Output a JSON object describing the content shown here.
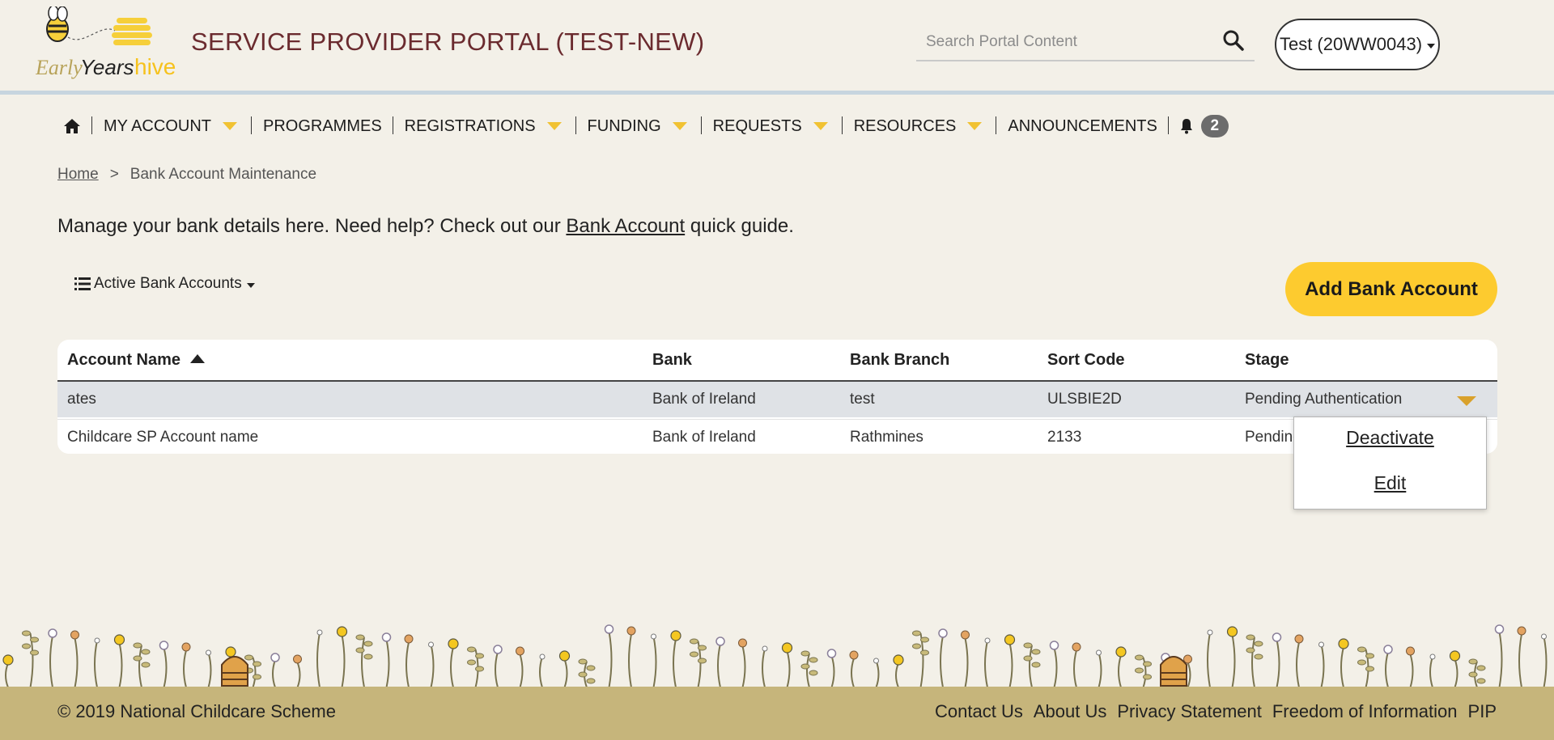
{
  "header": {
    "logo_text_1": "Early",
    "logo_text_2": "Years",
    "logo_text_3": "hive",
    "title": "SERVICE PROVIDER PORTAL (TEST-NEW)",
    "search_placeholder": "Search Portal Content",
    "account_label": "Test (20WW0043)"
  },
  "nav": {
    "items": [
      {
        "label": "MY ACCOUNT"
      },
      {
        "label": "PROGRAMMES"
      },
      {
        "label": "REGISTRATIONS"
      },
      {
        "label": "FUNDING"
      },
      {
        "label": "REQUESTS"
      },
      {
        "label": "RESOURCES"
      },
      {
        "label": "ANNOUNCEMENTS"
      }
    ],
    "notification_count": "2"
  },
  "breadcrumb": {
    "home": "Home",
    "separator": ">",
    "current": "Bank Account Maintenance"
  },
  "intro": {
    "text_before": "Manage your bank details here. Need help? Check out our ",
    "link": "Bank Account",
    "text_after": " quick guide."
  },
  "filter": {
    "label": "Active Bank Accounts"
  },
  "add_button": "Add Bank Account",
  "table": {
    "columns": [
      "Account Name",
      "Bank",
      "Bank Branch",
      "Sort Code",
      "Stage"
    ],
    "rows": [
      [
        "ates",
        "Bank of Ireland",
        "test",
        "ULSBIE2D",
        "Pending Authentication"
      ],
      [
        "Childcare SP Account name",
        "Bank of Ireland",
        "Rathmines",
        "2133",
        "Pending"
      ]
    ]
  },
  "row_menu": {
    "items": [
      "Deactivate",
      "Edit"
    ]
  },
  "footer": {
    "copyright": "© 2019 National Childcare Scheme",
    "links": [
      "Contact Us",
      "About Us",
      "Privacy Statement",
      "Freedom of Information",
      "PIP"
    ]
  },
  "colors": {
    "brand_title": "#6b2b2f",
    "accent_yellow": "#fdcb2f",
    "footer_bg": "#c6b57b",
    "page_bg": "#f3f0e8"
  }
}
